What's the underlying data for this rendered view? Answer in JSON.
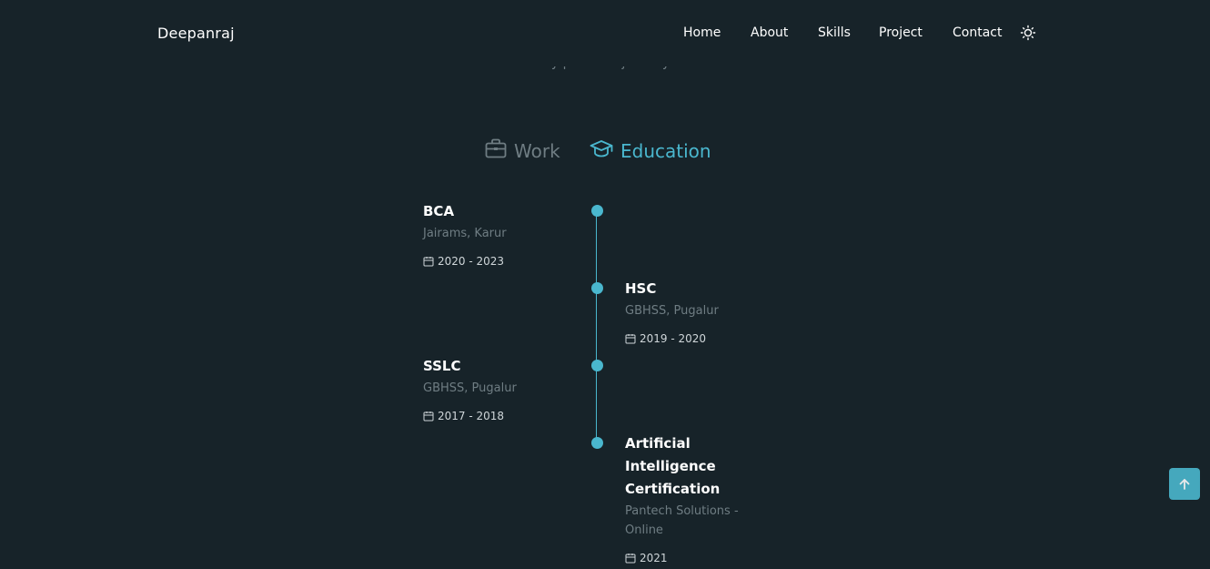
{
  "header": {
    "logo": "Deepanraj",
    "nav": [
      "Home",
      "About",
      "Skills",
      "Project",
      "Contact"
    ],
    "theme_icon": "sun-icon"
  },
  "section": {
    "subtitle": "My personal journey"
  },
  "tabs": {
    "work": "Work",
    "education": "Education",
    "active": "education"
  },
  "timeline": [
    {
      "title": "BCA",
      "subtitle": "Jairams, Karur",
      "date": "2020 - 2023",
      "side": "left"
    },
    {
      "title": "HSC",
      "subtitle": "GBHSS, Pugalur",
      "date": "2019 - 2020",
      "side": "right"
    },
    {
      "title": "SSLC",
      "subtitle": "GBHSS, Pugalur",
      "date": "2017 - 2018",
      "side": "left"
    },
    {
      "title": "Artificial Intelligence Certification",
      "subtitle": "Pantech Solutions - Online",
      "date": "2021",
      "side": "right"
    }
  ],
  "colors": {
    "background": "#172329",
    "accent": "#4ab7ce",
    "muted": "#6f7d83"
  }
}
